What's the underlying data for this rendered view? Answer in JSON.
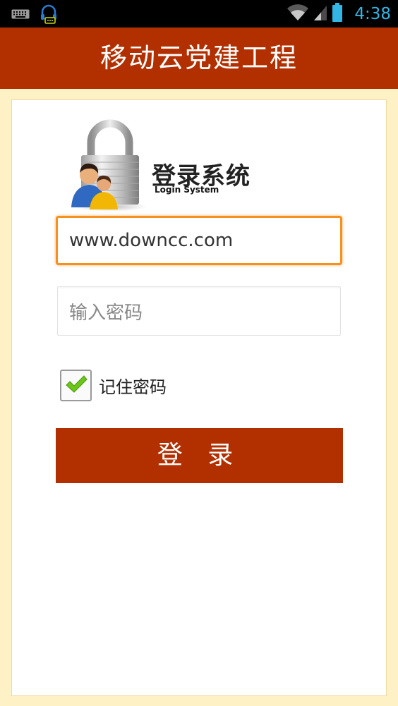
{
  "status_bar": {
    "time": "4:38",
    "icons": [
      "keyboard-icon",
      "headset-icon",
      "wifi-icon",
      "signal-icon",
      "battery-icon"
    ],
    "time_color": "#33b5e5"
  },
  "header": {
    "title": "移动云党建工程",
    "background": "#b22f00"
  },
  "brand": {
    "title": "登录系统",
    "subtitle": "Login System",
    "logo_icon": "padlock-users-icon"
  },
  "form": {
    "username_value": "www.downcc.com",
    "password_placeholder": "输入密码",
    "remember_label": "记住密码",
    "remember_checked": true,
    "login_label": "登 录"
  },
  "colors": {
    "accent": "#b22f00",
    "page_background": "#fef1c6",
    "focus_border": "#f6901e"
  }
}
